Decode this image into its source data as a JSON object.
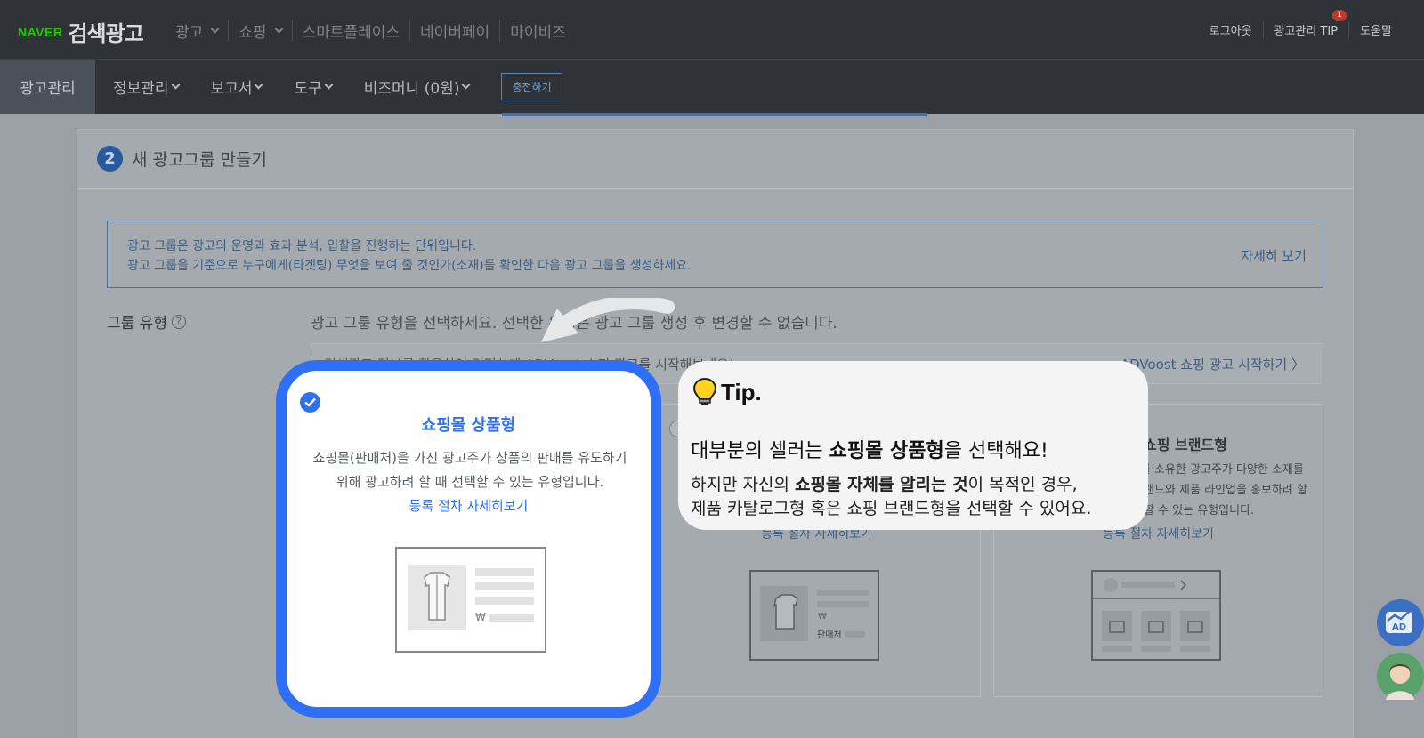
{
  "top_nav": {
    "naver": "NAVER",
    "brand": "검색광고",
    "menu": [
      "광고",
      "쇼핑",
      "스마트플레이스",
      "네이버페이",
      "마이비즈"
    ],
    "menu_chevrons": [
      true,
      true,
      false,
      false,
      false
    ],
    "right": [
      "로그아웃",
      "광고관리 TIP",
      "도움말"
    ],
    "notification_count": "1"
  },
  "sub_nav": {
    "active": "광고관리",
    "items": [
      "정보관리",
      "보고서",
      "도구",
      "비즈머니 (0원)"
    ],
    "charge_button": "충전하기"
  },
  "card": {
    "step_number": "2",
    "title": "새 광고그룹 만들기",
    "info_line1": "광고 그룹은 광고의 운영과 효과 분석, 입찰을 진행하는 단위입니다.",
    "info_line2": "광고 그룹을 기준으로 누구에게(타겟팅) 무엇을 보여 줄 것인가(소재)를 확인한 다음 광고 그룹을 생성하세요.",
    "info_more": "자세히 보기",
    "group_type_label": "그룹 유형",
    "group_type_help": "?",
    "group_type_desc": "광고 그룹 유형을 선택하세요. 선택한 유형은 광고 그룹 생성 후 변경할 수 없습니다.",
    "advoost_text": "검색광고 정보를 활용하여 간편하게 ADVoost 쇼핑 광고를 시작해보세요!",
    "advoost_link": "ADVoost 쇼핑 광고 시작하기 〉",
    "type2_link": "등록 절차 자세히보기",
    "type3_title": "쇼핑 브랜드형",
    "type3_desc": "브랜드를 소유한 광고주가 다양한 소재를 통해 브랜드와 제품 라인업을 홍보하려 할 때 선택할 수 있는 유형입니다.",
    "type3_link": "등록 절차 자세히보기",
    "seller_label": "판매처"
  },
  "highlight": {
    "title": "쇼핑몰 상품형",
    "desc": "쇼핑몰(판매처)을 가진 광고주가 상품의 판매를 유도하기 위해 광고하려 할 때 선택할 수 있는 유형입니다.",
    "link": "등록 절차 자세히보기",
    "currency": "₩"
  },
  "tip": {
    "heading": "Tip.",
    "main_pre": "대부분의 셀러는 ",
    "main_bold": "쇼핑몰 상품형",
    "main_post": "을 선택해요!",
    "sub1_pre": "하지만 자신의 ",
    "sub1_bold": "쇼핑몰 자체를 알리는 것",
    "sub1_post": "이 목적인 경우,",
    "sub2": "제품 카탈로그형 혹은 쇼핑 브랜드형을 선택할 수 있어요."
  },
  "floating": {
    "ad_label": "AD"
  },
  "colors": {
    "accent": "#2f6ff3",
    "naver_green": "#1ec800",
    "dark_nav": "#2f3337"
  }
}
